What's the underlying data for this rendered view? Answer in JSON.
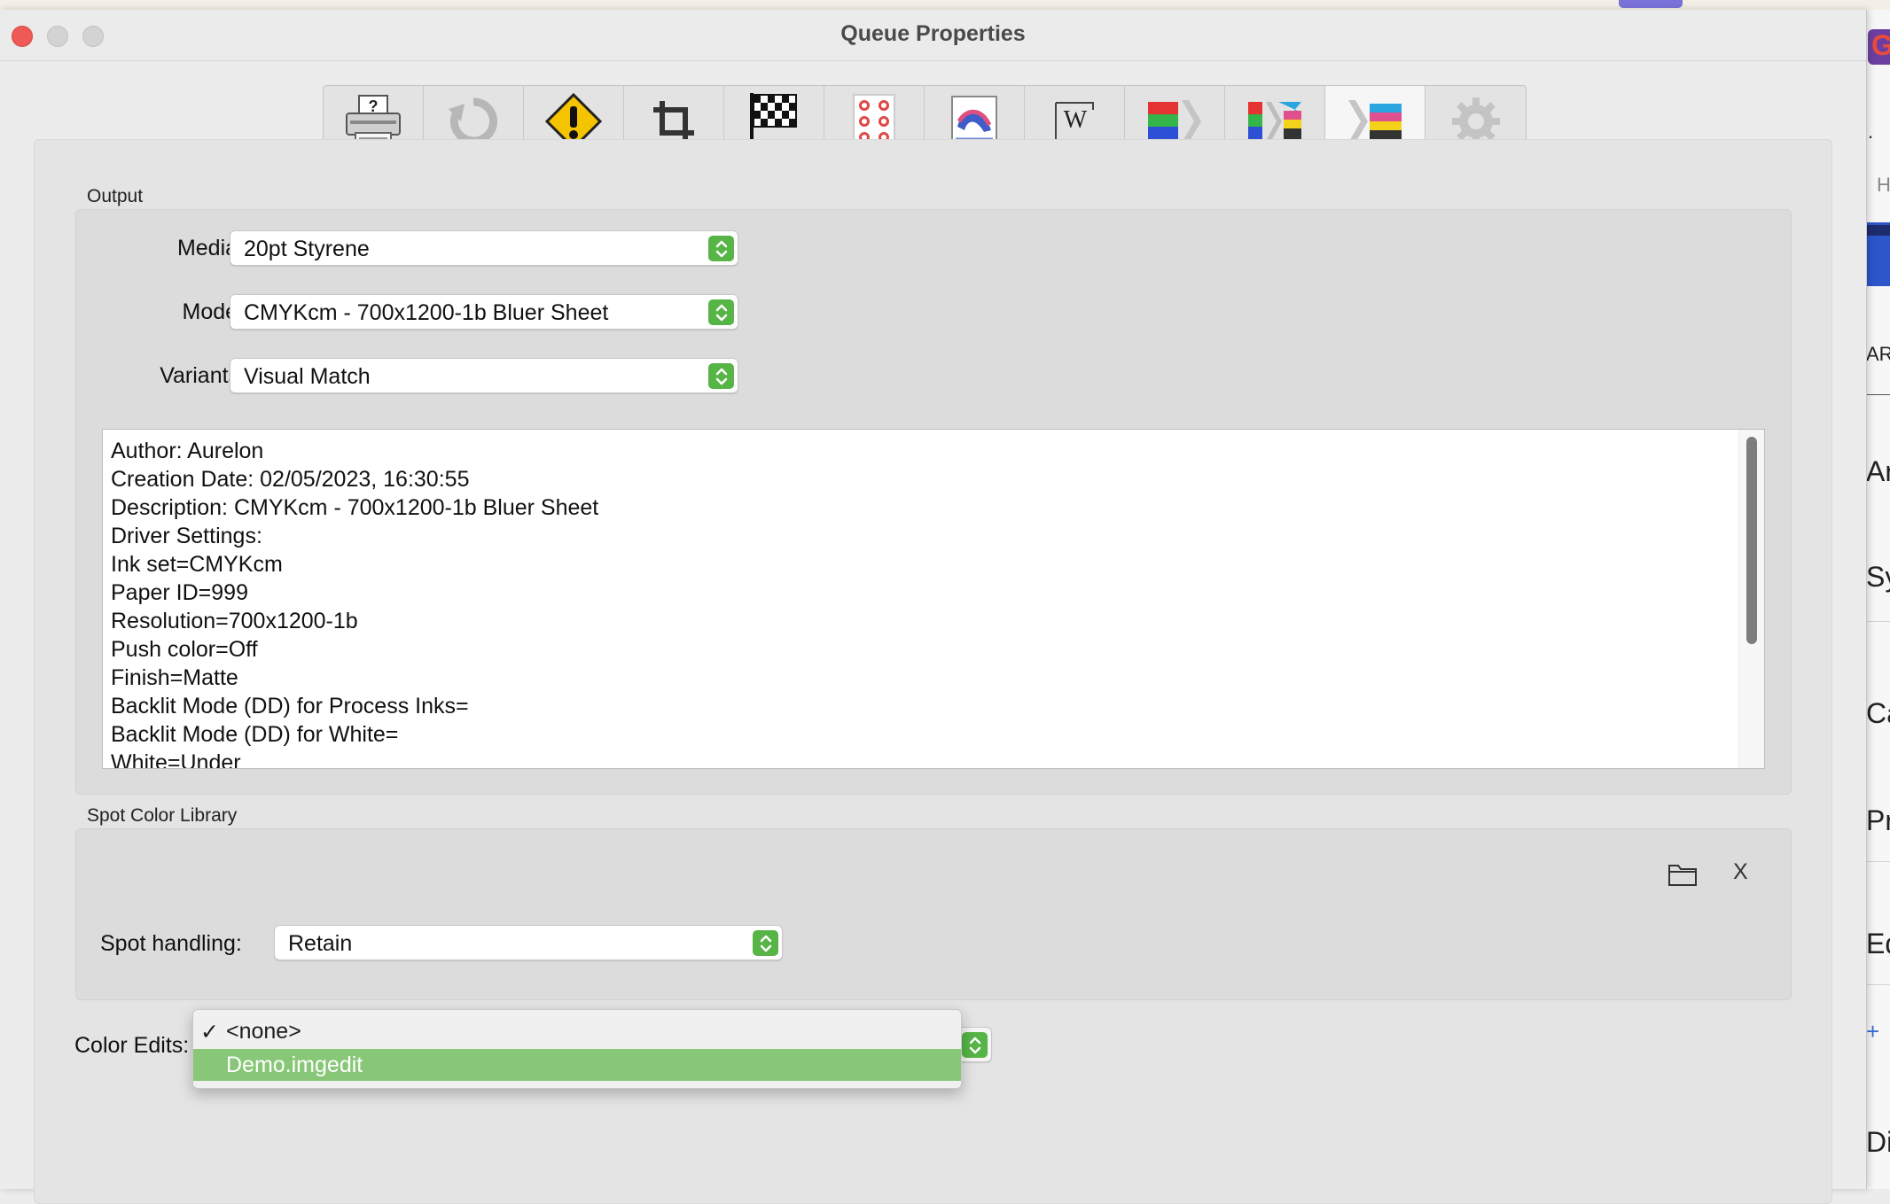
{
  "window": {
    "title": "Queue Properties"
  },
  "toolbar": [
    {
      "name": "printer-tab",
      "icon": "printer-icon"
    },
    {
      "name": "rotate-tab",
      "icon": "rotate-icon"
    },
    {
      "name": "warning-tab",
      "icon": "warning-icon"
    },
    {
      "name": "crop-tab",
      "icon": "crop-icon"
    },
    {
      "name": "finish-tab",
      "icon": "checkered-flag-icon"
    },
    {
      "name": "layout-tab",
      "icon": "dot-page-icon"
    },
    {
      "name": "image-tab",
      "icon": "image-page-icon"
    },
    {
      "name": "watermark-tab",
      "icon": "watermark-icon"
    },
    {
      "name": "color-tab",
      "icon": "color-bars-arrow-icon"
    },
    {
      "name": "color-convert-tab",
      "icon": "color-convert-icon"
    },
    {
      "name": "output-tab",
      "icon": "cmyk-output-icon",
      "active": true
    },
    {
      "name": "settings-tab",
      "icon": "gear-icon"
    }
  ],
  "output": {
    "section_label": "Output",
    "media_label": "Media:",
    "media_value": "20pt Styrene",
    "mode_label": "Mode:",
    "mode_value": "CMYKcm - 700x1200-1b Bluer Sheet",
    "variants_label": "Variants:",
    "variants_value": "Visual Match",
    "info_lines": [
      "Author: Aurelon",
      "Creation Date: 02/05/2023, 16:30:55",
      "Description: CMYKcm - 700x1200-1b Bluer Sheet",
      "Driver Settings:",
      "Ink set=CMYKcm",
      "Paper ID=999",
      "Resolution=700x1200-1b",
      "Push color=Off",
      "Finish=Matte",
      "Backlit Mode (DD) for Process Inks=",
      "Backlit Mode (DD) for White=",
      "White=Under"
    ]
  },
  "spot": {
    "section_label": "Spot Color Library",
    "clear_label": "X",
    "handling_label": "Spot handling:",
    "handling_value": "Retain"
  },
  "color_edits": {
    "label": "Color Edits:",
    "options": [
      {
        "check": "✓",
        "label": "<none>",
        "selected": true
      },
      {
        "check": "",
        "label": "Demo.imgedit",
        "highlighted": true
      }
    ]
  },
  "background_window": {
    "labels": [
      "G",
      "H",
      ".",
      "AR",
      "Ar",
      "Sys",
      "Ca",
      "Pri",
      "Edi",
      "+",
      "Dis"
    ]
  },
  "colors": {
    "stepper": "#57b446",
    "highlight": "#88c777",
    "close": "#ee5a55"
  }
}
